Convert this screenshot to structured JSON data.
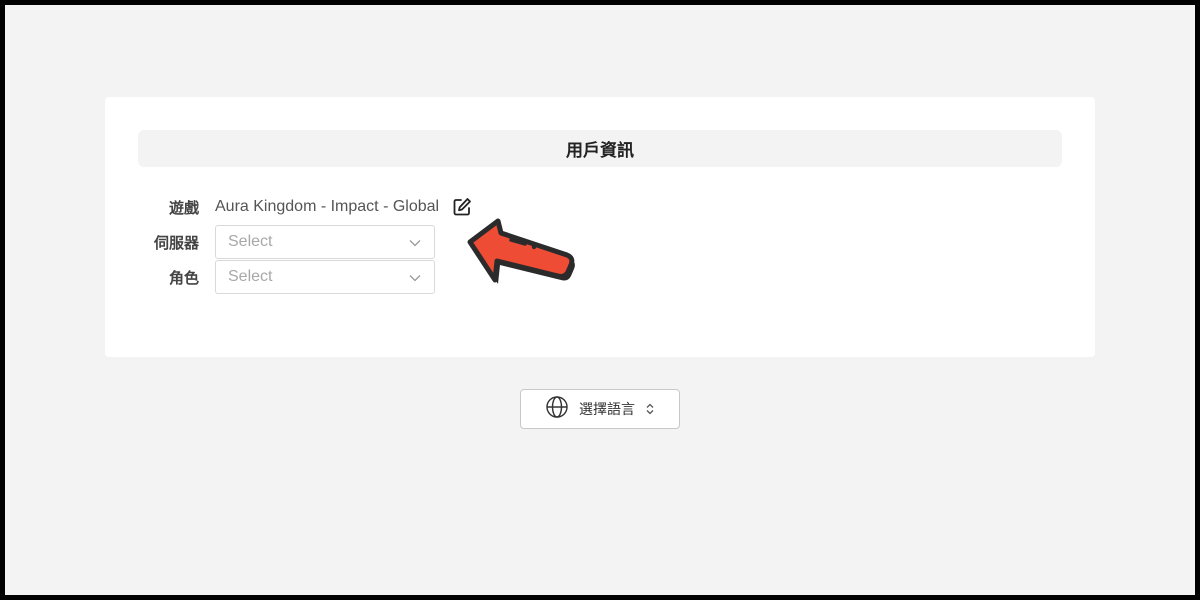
{
  "card": {
    "title": "用戶資訊"
  },
  "form": {
    "game": {
      "label": "遊戲",
      "value": "Aura Kingdom - Impact - Global",
      "edit_icon": "edit-icon"
    },
    "server": {
      "label": "伺服器",
      "placeholder": "Select",
      "icon": "chevron-down-icon"
    },
    "role": {
      "label": "角色",
      "placeholder": "Select",
      "icon": "chevron-down-icon"
    }
  },
  "language": {
    "label": "選擇語言",
    "icon": "globe-icon",
    "toggle_icon": "updown-chevron-icon"
  },
  "colors": {
    "background": "#f2f3f2",
    "card": "#ffffff",
    "arrow_fill": "#ee4c35",
    "arrow_outline": "#2b2b2b"
  }
}
